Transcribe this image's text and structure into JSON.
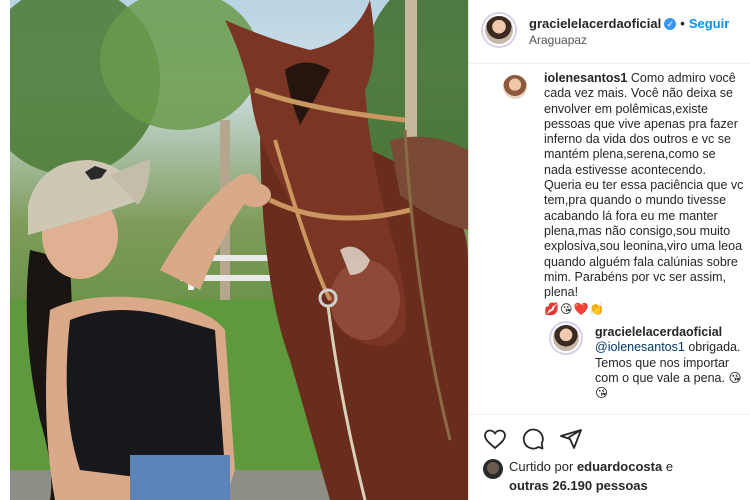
{
  "post": {
    "username": "gracielelacerdaoficial",
    "verified_icon": "verified-badge-icon",
    "separator": "•",
    "follow_label": "Seguir",
    "location": "Araguapaz"
  },
  "comment": {
    "username": "iolenesantos1",
    "text": "Como admiro você cada vez mais. Você não deixa se envolver em polêmicas,existe pessoas que vive apenas pra fazer inferno da vida dos outros e vc se mantém plena,serena,como se nada estivesse acontecendo. Queria eu ter essa paciência que vc tem,pra quando o mundo tivesse acabando lá fora eu me manter plena,mas não consigo,sou muito explosiva,sou leonina,viro uma leoa quando alguém fala calúnias sobre mim. Parabéns por vc ser assim, plena!",
    "emojis": "💋😘❤️👏"
  },
  "reply": {
    "username": "gracielelacerdaoficial",
    "mention": "@iolenesantos1",
    "text": "obrigada. Temos que nos importar com o que vale a pena.",
    "emojis": "😘😘"
  },
  "likes": {
    "prefix": "Curtido por",
    "user": "eduardocosta",
    "joiner": "e",
    "others": "outras 26.190 pessoas"
  },
  "icons": {
    "like": "heart-icon",
    "comment": "comment-icon",
    "share": "share-icon"
  },
  "colors": {
    "link_blue": "#0095f6",
    "verified_blue": "#3897f0",
    "text": "#262626"
  }
}
